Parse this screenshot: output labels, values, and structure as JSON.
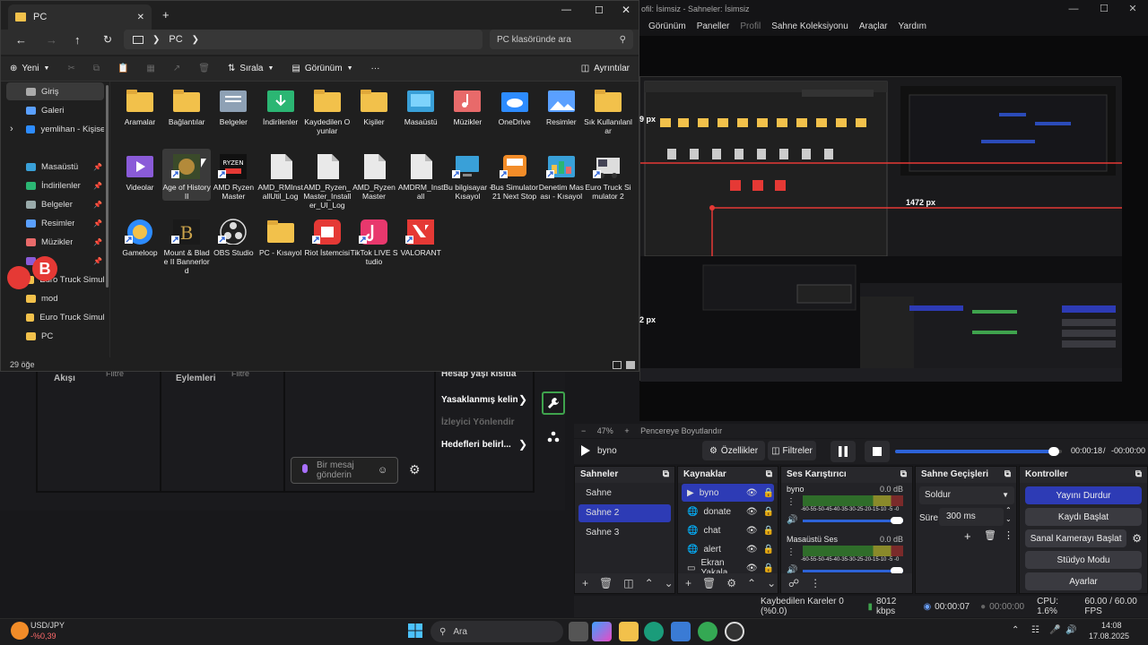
{
  "obs": {
    "title": "ofil: İsimsiz - Sahneler: İsimsiz",
    "menu": [
      "Görünüm",
      "Paneller",
      "Profil",
      "Sahne Koleksiyonu",
      "Araçlar",
      "Yardım"
    ],
    "preview_labels": {
      "width_px": "1472 px",
      "left_px": "9 px",
      "bottom_px": "2 px"
    },
    "chat": {
      "col1": "Akışı",
      "col1_filter": "Filtre",
      "col2": "Eylemleri",
      "col2_filter": "Filtre",
      "menu": [
        "Hesap yaşı kısıtla",
        "Yasaklanmış kelin",
        "İzleyici Yönlendir",
        "Hedefleri belirl..."
      ],
      "message_placeholder": "Bir mesaj gönderin"
    },
    "zoom": "47%",
    "zoom_mode": "Pencereye Boyutlandır",
    "source_name": "byno",
    "properties": "Özellikler",
    "filters": "Filtreler",
    "time_current": "00:00:18",
    "time_sep": "/",
    "time_total": "-00:00:00",
    "progress": 0.95,
    "scenes": {
      "title": "Sahneler",
      "items": [
        "Sahne",
        "Sahne 2",
        "Sahne 3"
      ],
      "selected": 1
    },
    "sources": {
      "title": "Kaynaklar",
      "items": [
        "byno",
        "donate",
        "chat",
        "alert",
        "Ekran Yakala"
      ],
      "selected": 0
    },
    "mixer": {
      "title": "Ses Karıştırıcı",
      "channels": [
        {
          "name": "byno",
          "db": "0.0 dB",
          "level": 0.82
        },
        {
          "name": "Masaüstü Ses",
          "db": "0.0 dB",
          "level": 0.82
        }
      ],
      "ticks": "-60-55-50-45-40-35-30-25-20-15-10 -5 -0"
    },
    "transitions": {
      "title": "Sahne Geçişleri",
      "type": "Soldur",
      "duration_label": "Süre",
      "duration": "300 ms"
    },
    "controls": {
      "title": "Kontroller",
      "buttons": [
        "Yayını Durdur",
        "Kaydı Başlat",
        "Sanal Kamerayı Başlat",
        "Stüdyo Modu",
        "Ayarlar"
      ]
    },
    "status": {
      "dropped": "Kaybedilen Kareler 0 (%0.0)",
      "bitrate": "8012 kbps",
      "stream_time": "00:00:07",
      "rec_time": "00:00:00",
      "cpu": "CPU: 1.6%",
      "fps": "60.00 / 60.00 FPS"
    }
  },
  "explorer": {
    "tab": "PC",
    "address": "PC",
    "search_placeholder": "PC klasöründe ara",
    "commands": {
      "new": "Yeni",
      "sort": "Sırala",
      "view": "Görünüm",
      "more": "···",
      "details": "Ayrıntılar"
    },
    "nav": [
      {
        "label": "Giriş",
        "icon": "home-icon",
        "selected": true
      },
      {
        "label": "Galeri",
        "icon": "gallery-icon"
      },
      {
        "label": "yemlihan - Kişisel",
        "icon": "onedrive-icon",
        "expand": true
      },
      {
        "label": "Masaüstü",
        "icon": "desktop-icon",
        "pin": true
      },
      {
        "label": "İndirilenler",
        "icon": "download-icon",
        "pin": true
      },
      {
        "label": "Belgeler",
        "icon": "documents-icon",
        "pin": true
      },
      {
        "label": "Resimler",
        "icon": "pictures-icon",
        "pin": true
      },
      {
        "label": "Müzikler",
        "icon": "music-icon",
        "pin": true
      },
      {
        "label": "ler",
        "icon": "videos-icon",
        "pin": true
      },
      {
        "label": "Euro Truck Simulato",
        "icon": "folder-icon"
      },
      {
        "label": "mod",
        "icon": "folder-icon"
      },
      {
        "label": "Euro Truck Simulato",
        "icon": "folder-icon"
      },
      {
        "label": "PC",
        "icon": "folder-icon"
      }
    ],
    "items": [
      {
        "label": "Aramalar",
        "icon": "folder"
      },
      {
        "label": "Bağlantılar",
        "icon": "folder"
      },
      {
        "label": "Belgeler",
        "icon": "docs"
      },
      {
        "label": "İndirilenler",
        "icon": "download"
      },
      {
        "label": "Kaydedilen Oyunlar",
        "icon": "folder"
      },
      {
        "label": "Kişiler",
        "icon": "folder"
      },
      {
        "label": "Masaüstü",
        "icon": "desktop"
      },
      {
        "label": "Müzikler",
        "icon": "music"
      },
      {
        "label": "OneDrive",
        "icon": "onedrive"
      },
      {
        "label": "Resimler",
        "icon": "pictures"
      },
      {
        "label": "Sık Kullanılanlar",
        "icon": "folder"
      },
      {
        "label": "Videolar",
        "icon": "videos"
      },
      {
        "label": "Age of History II",
        "icon": "game"
      },
      {
        "label": "AMD Ryzen Master",
        "icon": "ryzen"
      },
      {
        "label": "AMD_RMInstallUtil_Log",
        "icon": "file"
      },
      {
        "label": "AMD_Ryzen_Master_Installer_UI_Log",
        "icon": "file"
      },
      {
        "label": "AMD_RyzenMaster",
        "icon": "file"
      },
      {
        "label": "AMDRM_Install",
        "icon": "file"
      },
      {
        "label": "Bu bilgisayar - Kısayol",
        "icon": "pc"
      },
      {
        "label": "Bus Simulator 21 Next Stop",
        "icon": "bus"
      },
      {
        "label": "Denetim Masası - Kısayol",
        "icon": "control"
      },
      {
        "label": "Euro Truck Simulator 2",
        "icon": "truck"
      },
      {
        "label": "Gameloop",
        "icon": "gameloop"
      },
      {
        "label": "Mount & Blade II Bannerlord",
        "icon": "mb"
      },
      {
        "label": "OBS Studio",
        "icon": "obs"
      },
      {
        "label": "PC - Kısayol",
        "icon": "folder"
      },
      {
        "label": "Riot İstemcisi",
        "icon": "riot"
      },
      {
        "label": "TikTok LIVE Studio",
        "icon": "tiktok"
      },
      {
        "label": "VALORANT",
        "icon": "valorant"
      }
    ],
    "status": "29 öğe"
  },
  "taskbar": {
    "ticker_symbol": "USD/JPY",
    "ticker_change": "-%0,39",
    "search_placeholder": "Ara",
    "time": "14:08",
    "date": "17.08.2025"
  },
  "colors": {
    "accent": "#2d3bb5",
    "folder": "#f2c14b",
    "danger": "#e53935"
  }
}
